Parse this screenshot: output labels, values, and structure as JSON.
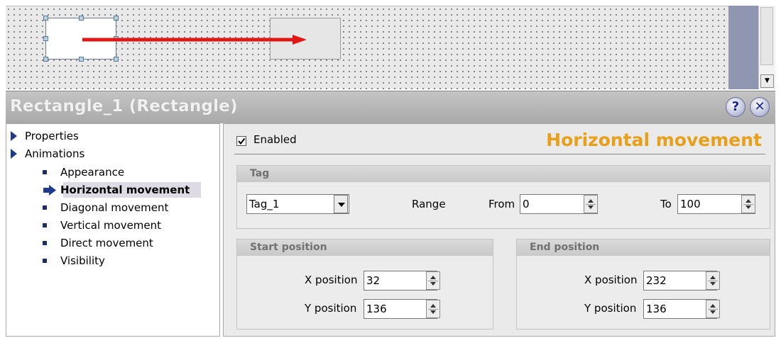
{
  "inspector": {
    "title": "Rectangle_1 (Rectangle)",
    "help_icon": "help-pin-icon",
    "close_icon": "close-icon"
  },
  "tree": {
    "items": [
      {
        "label": "Properties"
      },
      {
        "label": "Animations"
      },
      {
        "label": "Appearance"
      },
      {
        "label": "Horizontal movement",
        "selected": true
      },
      {
        "label": "Diagonal movement"
      },
      {
        "label": "Vertical movement"
      },
      {
        "label": "Direct movement"
      },
      {
        "label": "Visibility"
      }
    ]
  },
  "panel": {
    "enabled_label": "Enabled",
    "enabled_checked": true,
    "title": "Horizontal movement",
    "title_color": "#e8a01a",
    "tag_group": {
      "title": "Tag",
      "tag_value": "Tag_1",
      "range_label": "Range",
      "from_label": "From",
      "from_value": "0",
      "to_label": "To",
      "to_value": "100"
    },
    "start_group": {
      "title": "Start position",
      "x_label": "X position",
      "x_value": "32",
      "y_label": "Y position",
      "y_value": "136"
    },
    "end_group": {
      "title": "End position",
      "x_label": "X position",
      "x_value": "232",
      "y_label": "Y position",
      "y_value": "136"
    }
  },
  "colors": {
    "arrow": "#e01818",
    "tree_icon": "#1d3a8e"
  }
}
